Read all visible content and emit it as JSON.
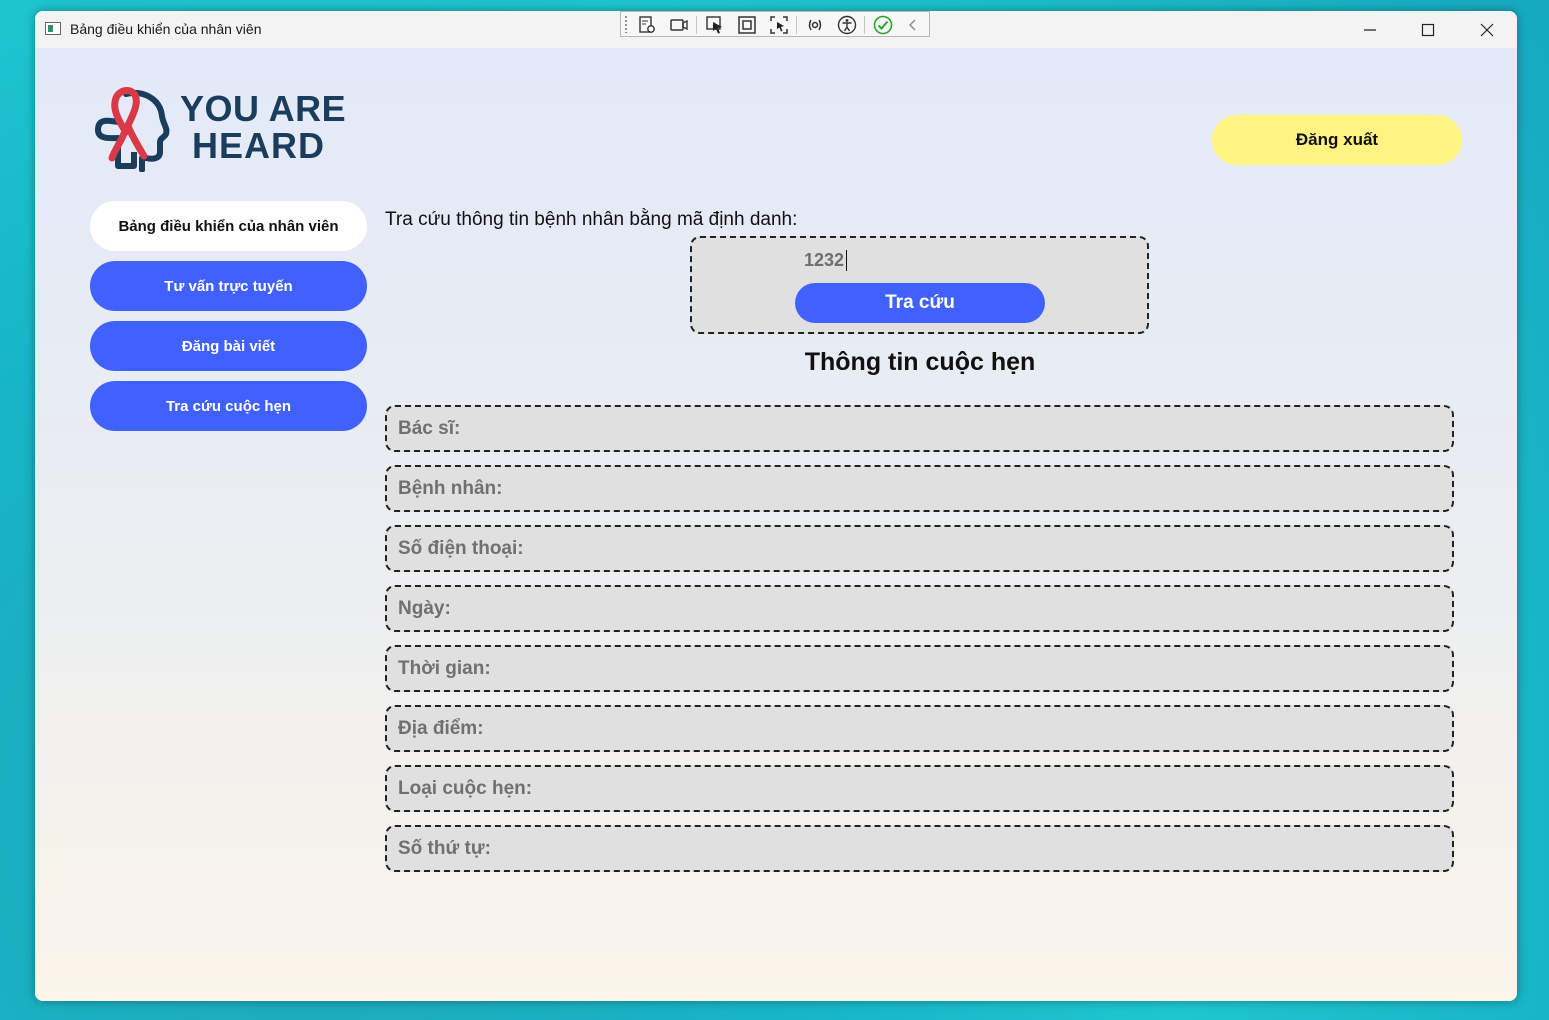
{
  "window": {
    "title": "Bảng điều khiển của nhân viên"
  },
  "devtools": {
    "icons": [
      "live-visual-tree-icon",
      "record-icon",
      "select-element-icon",
      "display-layout-adorners-icon",
      "track-focus-icon",
      "binding-failures-icon",
      "accessibility-icon",
      "checkmark-icon",
      "collapse-chevron-icon"
    ]
  },
  "logo": {
    "line1": "YOU ARE",
    "line2": "HEARD"
  },
  "header": {
    "logout_label": "Đăng xuất"
  },
  "sidebar": {
    "items": [
      {
        "label": "Bảng điều khiển của nhân viên",
        "active": true
      },
      {
        "label": "Tư vấn trực tuyến",
        "active": false
      },
      {
        "label": "Đăng bài viết",
        "active": false
      },
      {
        "label": "Tra cứu cuộc hẹn",
        "active": false
      }
    ]
  },
  "search": {
    "prompt": "Tra cứu thông tin bệnh nhân bằng mã định danh:",
    "id_value": "1232",
    "button_label": "Tra cứu"
  },
  "appointment": {
    "title": "Thông tin cuộc hẹn",
    "fields": [
      {
        "label": "Bác sĩ:"
      },
      {
        "label": "Bệnh nhân:"
      },
      {
        "label": "Số điện thoại:"
      },
      {
        "label": "Ngày:"
      },
      {
        "label": "Thời gian:"
      },
      {
        "label": "Địa điểm:"
      },
      {
        "label": "Loại cuộc hẹn:"
      },
      {
        "label": "Số thứ tự:"
      }
    ]
  },
  "colors": {
    "primary_button": "#4161ff",
    "logout_button": "#fff382",
    "logo_text": "#1a3d5c",
    "ribbon": "#d83a48"
  }
}
